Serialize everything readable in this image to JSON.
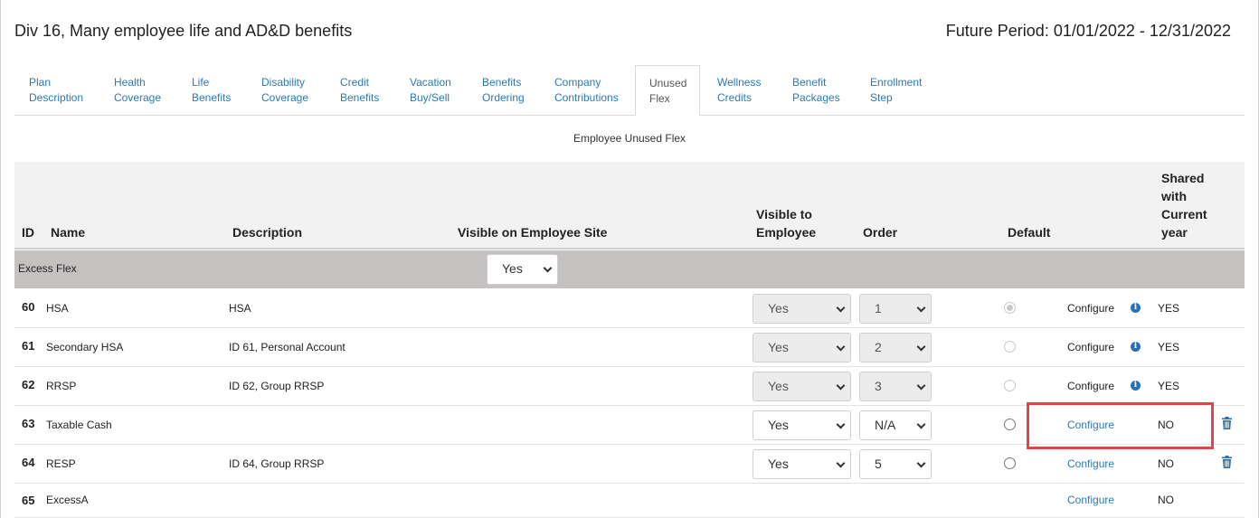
{
  "header": {
    "title": "Div 16, Many employee life and AD&D benefits",
    "period": "Future Period: 01/01/2022 - 12/31/2022"
  },
  "tabs": [
    {
      "line1": "Plan",
      "line2": "Description"
    },
    {
      "line1": "Health",
      "line2": "Coverage"
    },
    {
      "line1": "Life",
      "line2": "Benefits"
    },
    {
      "line1": "Disability",
      "line2": "Coverage"
    },
    {
      "line1": "Credit",
      "line2": "Benefits"
    },
    {
      "line1": "Vacation",
      "line2": "Buy/Sell"
    },
    {
      "line1": "Benefits",
      "line2": "Ordering"
    },
    {
      "line1": "Company",
      "line2": "Contributions"
    },
    {
      "line1": "Unused",
      "line2": "Flex",
      "active": true
    },
    {
      "line1": "Wellness",
      "line2": "Credits"
    },
    {
      "line1": "Benefit",
      "line2": "Packages"
    },
    {
      "line1": "Enrollment",
      "line2": "Step"
    }
  ],
  "section_title": "Employee Unused Flex",
  "columns": {
    "id": "ID",
    "name": "Name",
    "description": "Description",
    "visible_site": "Visible on Employee Site",
    "visible_emp_1": "Visible to",
    "visible_emp_2": "Employee",
    "order": "Order",
    "default": "Default",
    "shared_1": "Shared",
    "shared_2": "with",
    "shared_3": "Current",
    "shared_4": "year"
  },
  "group": {
    "name": "Excess Flex",
    "visible_site_value": "Yes"
  },
  "rows": [
    {
      "id": "60",
      "name": "HSA",
      "description": "HSA",
      "visible": "Yes",
      "order": "1",
      "configure": "Configure",
      "shared": "YES"
    },
    {
      "id": "61",
      "name": "Secondary HSA",
      "description": "ID 61, Personal Account",
      "visible": "Yes",
      "order": "2",
      "configure": "Configure",
      "shared": "YES"
    },
    {
      "id": "62",
      "name": "RRSP",
      "description": "ID 62, Group RRSP",
      "visible": "Yes",
      "order": "3",
      "configure": "Configure",
      "shared": "YES"
    },
    {
      "id": "63",
      "name": "Taxable Cash",
      "description": "",
      "visible": "Yes",
      "order": "N/A",
      "configure": "Configure",
      "shared": "NO"
    },
    {
      "id": "64",
      "name": "RESP",
      "description": "ID 64, Group RRSP",
      "visible": "Yes",
      "order": "5",
      "configure": "Configure",
      "shared": "NO"
    },
    {
      "id": "65",
      "name": "ExcessA",
      "description": "",
      "configure": "Configure",
      "shared": "NO"
    }
  ],
  "icons": {
    "info": "info-icon",
    "trash": "trash-icon",
    "dropdown": "chevron-down-icon"
  },
  "colors": {
    "link": "#2a7ab8",
    "highlight": "#e0454a",
    "group_bg": "#c5c1c1"
  }
}
